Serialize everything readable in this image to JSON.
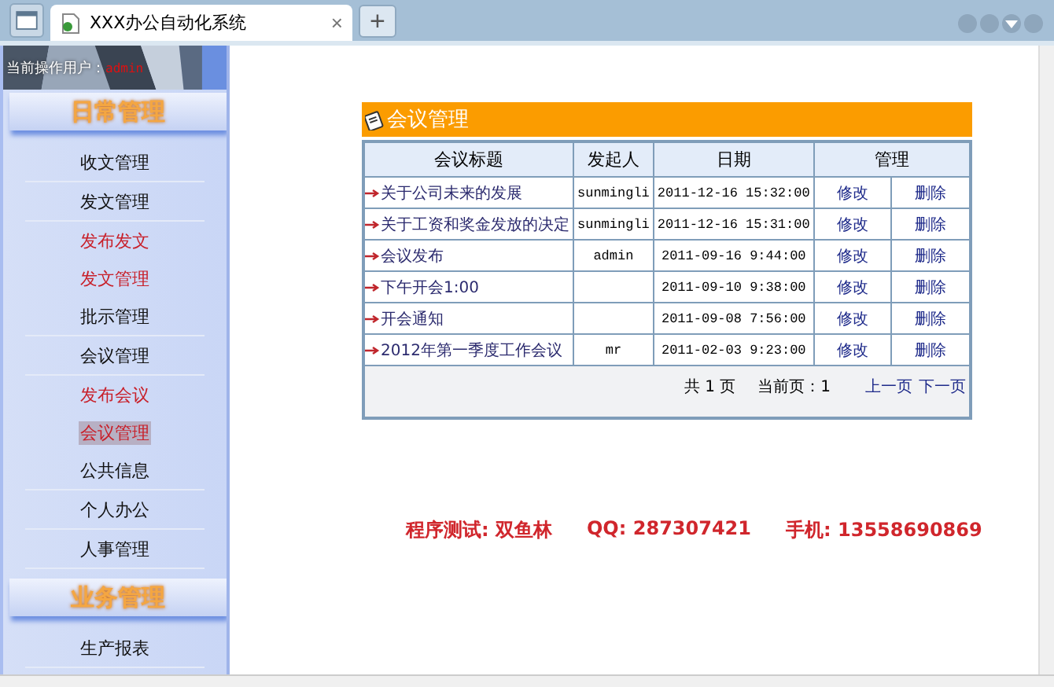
{
  "browser": {
    "tab_title": "XXX办公自动化系统",
    "tab_close": "×",
    "new_tab": "+"
  },
  "sidebar": {
    "user_label": "当前操作用户：",
    "user": "admin",
    "sections": [
      {
        "title": "日常管理",
        "items": [
          {
            "label": "收文管理",
            "kind": "main",
            "selected": false
          },
          {
            "label": "发文管理",
            "kind": "main",
            "selected": false
          },
          {
            "label": "发布发文",
            "kind": "sub",
            "selected": false
          },
          {
            "label": "发文管理",
            "kind": "sub",
            "selected": false
          },
          {
            "label": "批示管理",
            "kind": "main",
            "selected": false
          },
          {
            "label": "会议管理",
            "kind": "main",
            "selected": false
          },
          {
            "label": "发布会议",
            "kind": "sub",
            "selected": false
          },
          {
            "label": "会议管理",
            "kind": "sub",
            "selected": true
          },
          {
            "label": "公共信息",
            "kind": "main",
            "selected": false
          },
          {
            "label": "个人办公",
            "kind": "main",
            "selected": false
          },
          {
            "label": "人事管理",
            "kind": "main",
            "selected": false
          }
        ]
      },
      {
        "title": "业务管理",
        "items": [
          {
            "label": "生产报表",
            "kind": "main",
            "selected": false
          }
        ]
      }
    ]
  },
  "panel": {
    "title": "会议管理",
    "columns": [
      "会议标题",
      "发起人",
      "日期",
      "管理"
    ],
    "rows": [
      {
        "title": "关于公司未来的发展",
        "initiator": "sunmingli",
        "date": "2011-12-16 15:32:00",
        "actions": [
          "修改",
          "删除"
        ]
      },
      {
        "title": "关于工资和奖金发放的决定",
        "initiator": "sunmingli",
        "date": "2011-12-16 15:31:00",
        "actions": [
          "修改",
          "删除"
        ]
      },
      {
        "title": "会议发布",
        "initiator": "admin",
        "date": "2011-09-16 9:44:00",
        "actions": [
          "修改",
          "删除"
        ]
      },
      {
        "title": "下午开会1:00",
        "initiator": "",
        "date": "2011-09-10 9:38:00",
        "actions": [
          "修改",
          "删除"
        ]
      },
      {
        "title": "开会通知",
        "initiator": "",
        "date": "2011-09-08 7:56:00",
        "actions": [
          "修改",
          "删除"
        ]
      },
      {
        "title": "2012年第一季度工作会议",
        "initiator": "mr",
        "date": "2011-02-03 9:23:00",
        "actions": [
          "修改",
          "删除"
        ]
      }
    ],
    "pager": {
      "total": "共 1 页",
      "current": "当前页：1",
      "prev": "上一页",
      "next": "下一页"
    }
  },
  "credits": [
    "程序测试: 双鱼林",
    "QQ: 287307421",
    "手机: 13558690869"
  ]
}
